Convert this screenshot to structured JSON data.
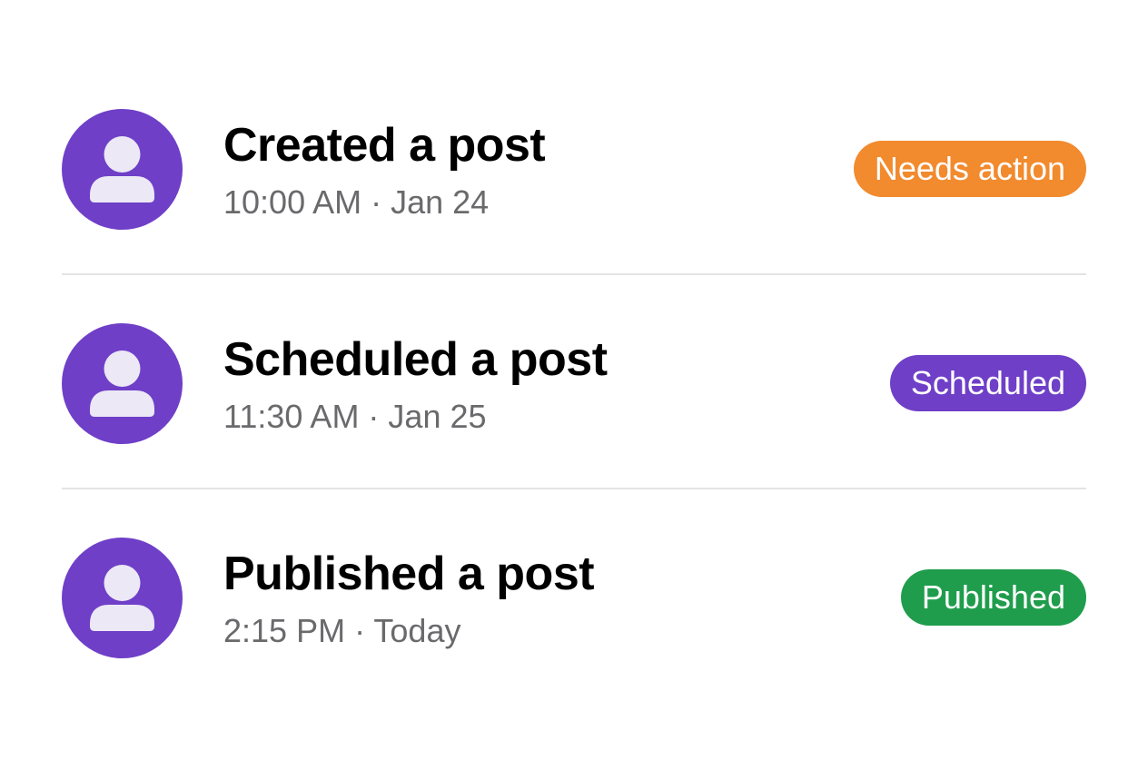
{
  "activities": [
    {
      "title": "Created a post",
      "time": "10:00 AM",
      "separator": "·",
      "date": "Jan 24",
      "meta": "10:00 AM · Jan 24",
      "badge": {
        "label": "Needs action",
        "color": "#F28A2E"
      },
      "avatar": {
        "icon": "user-icon",
        "color": "#6F3FC8"
      }
    },
    {
      "title": "Scheduled a post",
      "time": "11:30 AM",
      "separator": "·",
      "date": "Jan 25",
      "meta": "11:30 AM · Jan 25",
      "badge": {
        "label": "Scheduled",
        "color": "#6F3FC8"
      },
      "avatar": {
        "icon": "user-icon",
        "color": "#6F3FC8"
      }
    },
    {
      "title": "Published a post",
      "time": "2:15 PM",
      "separator": "·",
      "date": "Today",
      "meta": "2:15 PM · Today",
      "badge": {
        "label": "Published",
        "color": "#1F9D4C"
      },
      "avatar": {
        "icon": "user-icon",
        "color": "#6F3FC8"
      }
    }
  ]
}
